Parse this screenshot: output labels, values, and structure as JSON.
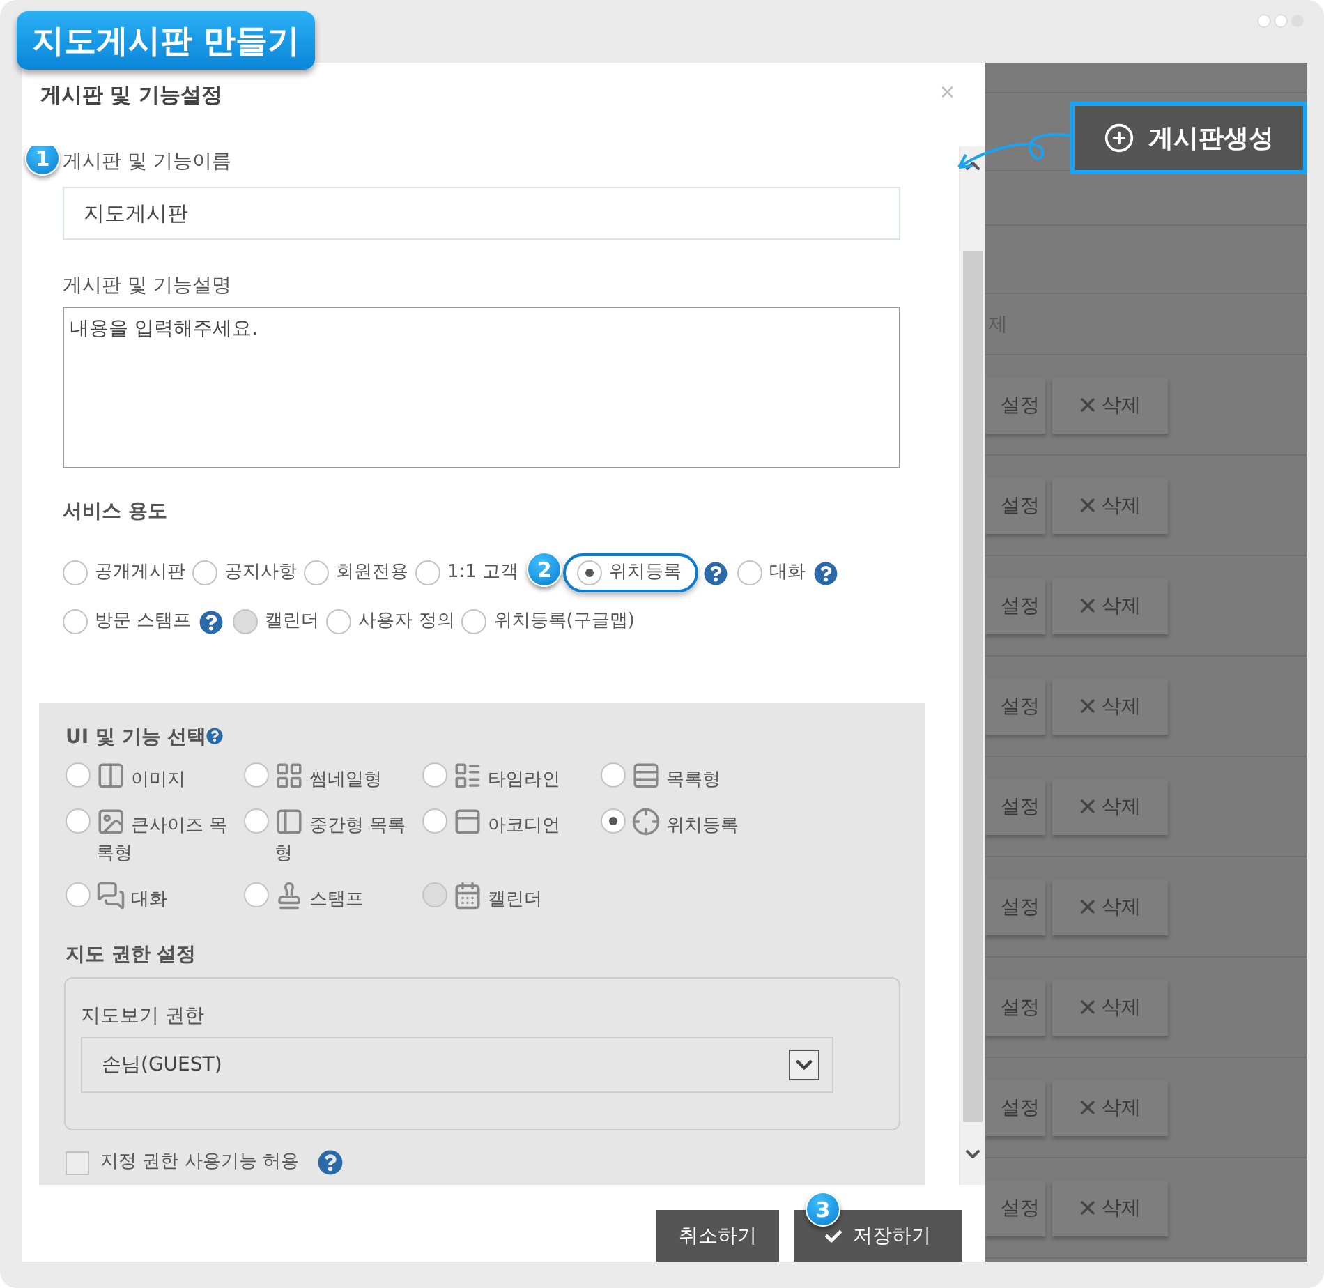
{
  "header": {
    "title": "지도게시판 만들기"
  },
  "create_button": {
    "label": "게시판생성"
  },
  "background": {
    "partial_text": "제",
    "rows": [
      {
        "settings": "설정",
        "delete": "삭제"
      },
      {
        "settings": "설정",
        "delete": "삭제"
      },
      {
        "settings": "설정",
        "delete": "삭제"
      },
      {
        "settings": "설정",
        "delete": "삭제"
      },
      {
        "settings": "설정",
        "delete": "삭제"
      },
      {
        "settings": "설정",
        "delete": "삭제"
      },
      {
        "settings": "설정",
        "delete": "삭제"
      },
      {
        "settings": "설정",
        "delete": "삭제"
      },
      {
        "settings": "설정",
        "delete": "삭제"
      }
    ]
  },
  "dialog": {
    "title": "게시판 및 기능설정",
    "close": "×",
    "name_field": {
      "step": "1",
      "label": "게시판 및 기능이름",
      "value": "지도게시판"
    },
    "description_field": {
      "label": "게시판 및 기능설명",
      "placeholder": "내용을 입력해주세요."
    },
    "service": {
      "heading": "서비스 용도",
      "option_rows": [
        [
          {
            "label": "공개게시판",
            "selected": false,
            "disabled": false,
            "help": false
          },
          {
            "label": "공지사항",
            "selected": false,
            "disabled": false,
            "help": false
          },
          {
            "label": "회원전용",
            "selected": false,
            "disabled": false,
            "help": false
          },
          {
            "label": "1:1 고객",
            "selected": false,
            "disabled": false,
            "help": false
          },
          {
            "label": "위치등록",
            "selected": true,
            "disabled": false,
            "help": true,
            "step": "2"
          },
          {
            "label": "대화",
            "selected": false,
            "disabled": false,
            "help": true
          }
        ],
        [
          {
            "label": "방문 스탬프",
            "selected": false,
            "disabled": false,
            "help": true
          },
          {
            "label": "캘린더",
            "selected": false,
            "disabled": true,
            "help": false
          },
          {
            "label": "사용자 정의",
            "selected": false,
            "disabled": false,
            "help": false
          },
          {
            "label": "위치등록(구글맵)",
            "selected": false,
            "disabled": false,
            "help": false
          }
        ]
      ]
    },
    "ui": {
      "heading": "UI 및 기능 선택",
      "options": [
        {
          "label": "이미지",
          "selected": false,
          "disabled": false
        },
        {
          "label": "썸네일형",
          "selected": false,
          "disabled": false
        },
        {
          "label": "타임라인",
          "selected": false,
          "disabled": false
        },
        {
          "label": "목록형",
          "selected": false,
          "disabled": false
        },
        {
          "label": "큰사이즈 목록형",
          "selected": false,
          "disabled": false
        },
        {
          "label": "중간형 목록형",
          "selected": false,
          "disabled": false
        },
        {
          "label": "아코디언",
          "selected": false,
          "disabled": false
        },
        {
          "label": "위치등록",
          "selected": true,
          "disabled": false
        },
        {
          "label": "대화",
          "selected": false,
          "disabled": false
        },
        {
          "label": "스탬프",
          "selected": false,
          "disabled": false
        },
        {
          "label": "캘린더",
          "selected": false,
          "disabled": true
        }
      ]
    },
    "permission": {
      "heading": "지도 권한 설정",
      "label": "지도보기 권한",
      "select_value": "손님(GUEST)"
    },
    "allow": {
      "label": "지정 권한 사용기능 허용",
      "checked": false
    },
    "buttons": [
      {
        "label": "취소하기",
        "kind": "cancel"
      },
      {
        "label": "저장하기",
        "kind": "save",
        "step": "3"
      }
    ]
  }
}
